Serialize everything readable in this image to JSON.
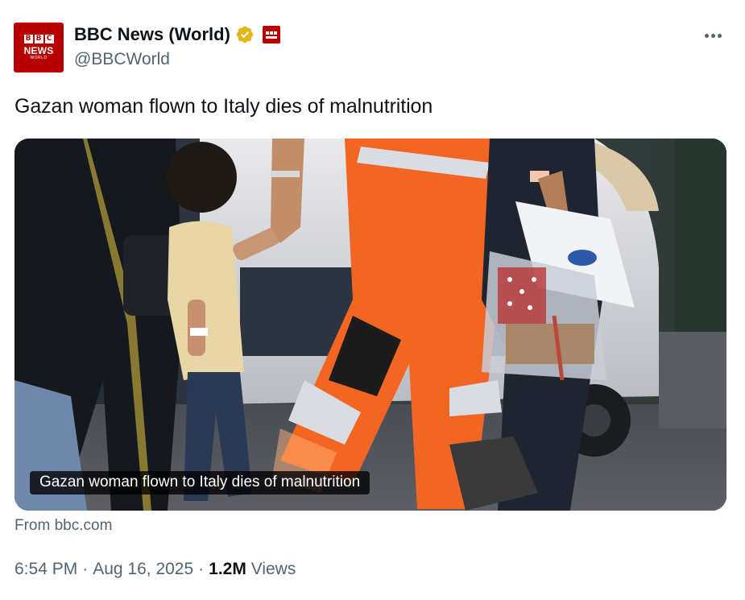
{
  "author": {
    "display_name": "BBC News (World)",
    "handle": "@BBCWorld",
    "avatar": {
      "blocks": [
        "B",
        "B",
        "C"
      ],
      "line1": "NEWS",
      "line2": "WORLD"
    },
    "verified_icon": "verified-gold-badge-icon",
    "affiliate_icon": "bbc-affiliate-badge-icon"
  },
  "more_icon": "more-horizontal-icon",
  "tweet": {
    "text": "Gazan woman flown to Italy dies of malnutrition"
  },
  "card": {
    "overlay_title": "Gazan woman flown to Italy dies of malnutrition",
    "source": "From bbc.com"
  },
  "meta": {
    "time": "6:54 PM",
    "sep1": "·",
    "date": "Aug 16, 2025",
    "sep2": "·",
    "views_count": "1.2M",
    "views_label": "Views"
  },
  "colors": {
    "bbc_red": "#b80000",
    "verified_gold": "#e2b719",
    "secondary_text": "#536471",
    "primary_text": "#0f1419",
    "orange_suit": "#f26522"
  }
}
